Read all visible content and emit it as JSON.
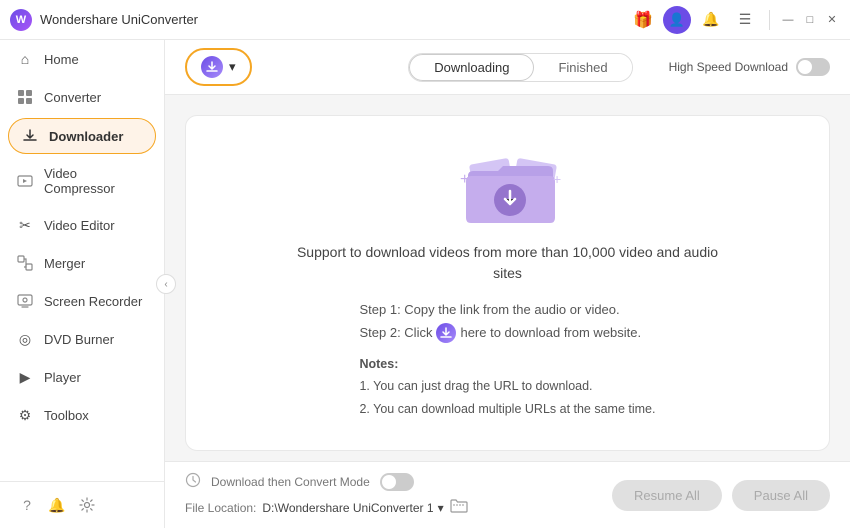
{
  "titlebar": {
    "logo_text": "W",
    "title": "Wondershare UniConverter",
    "icons": {
      "gift": "🎁",
      "avatar": "👤",
      "bell": "🔔",
      "menu": "☰",
      "minimize": "—",
      "maximize": "□",
      "close": "✕"
    }
  },
  "sidebar": {
    "items": [
      {
        "id": "home",
        "label": "Home",
        "icon": "⌂"
      },
      {
        "id": "converter",
        "label": "Converter",
        "icon": "⬡"
      },
      {
        "id": "downloader",
        "label": "Downloader",
        "icon": "⬇"
      },
      {
        "id": "video-compressor",
        "label": "Video Compressor",
        "icon": "⊞"
      },
      {
        "id": "video-editor",
        "label": "Video Editor",
        "icon": "✂"
      },
      {
        "id": "merger",
        "label": "Merger",
        "icon": "⊟"
      },
      {
        "id": "screen-recorder",
        "label": "Screen Recorder",
        "icon": "⊡"
      },
      {
        "id": "dvd-burner",
        "label": "DVD Burner",
        "icon": "◎"
      },
      {
        "id": "player",
        "label": "Player",
        "icon": "▶"
      },
      {
        "id": "toolbox",
        "label": "Toolbox",
        "icon": "⚙"
      }
    ],
    "active_item": "downloader",
    "bottom_icons": {
      "help": "?",
      "bell": "🔔",
      "settings": "⚙"
    }
  },
  "header": {
    "download_button_label": "▾",
    "tabs": {
      "downloading": "Downloading",
      "finished": "Finished",
      "active": "downloading"
    },
    "high_speed": {
      "label": "High Speed Download",
      "enabled": false
    }
  },
  "main": {
    "illustration_alt": "Download folder",
    "title_line1": "Support to download videos from more than 10,000 video and audio",
    "title_line2": "sites",
    "step1": "Step 1: Copy the link from the audio or video.",
    "step2_pre": "Step 2: Click",
    "step2_post": "here to download from website.",
    "notes_label": "Notes:",
    "note1": "1. You can just drag the URL to download.",
    "note2": "2. You can download multiple URLs at the same time."
  },
  "footer": {
    "convert_mode_label": "Download then Convert Mode",
    "convert_mode_enabled": false,
    "file_location_label": "File Location:",
    "file_path": "D:\\Wondershare UniConverter 1",
    "resume_btn": "Resume All",
    "pause_btn": "Pause All"
  }
}
